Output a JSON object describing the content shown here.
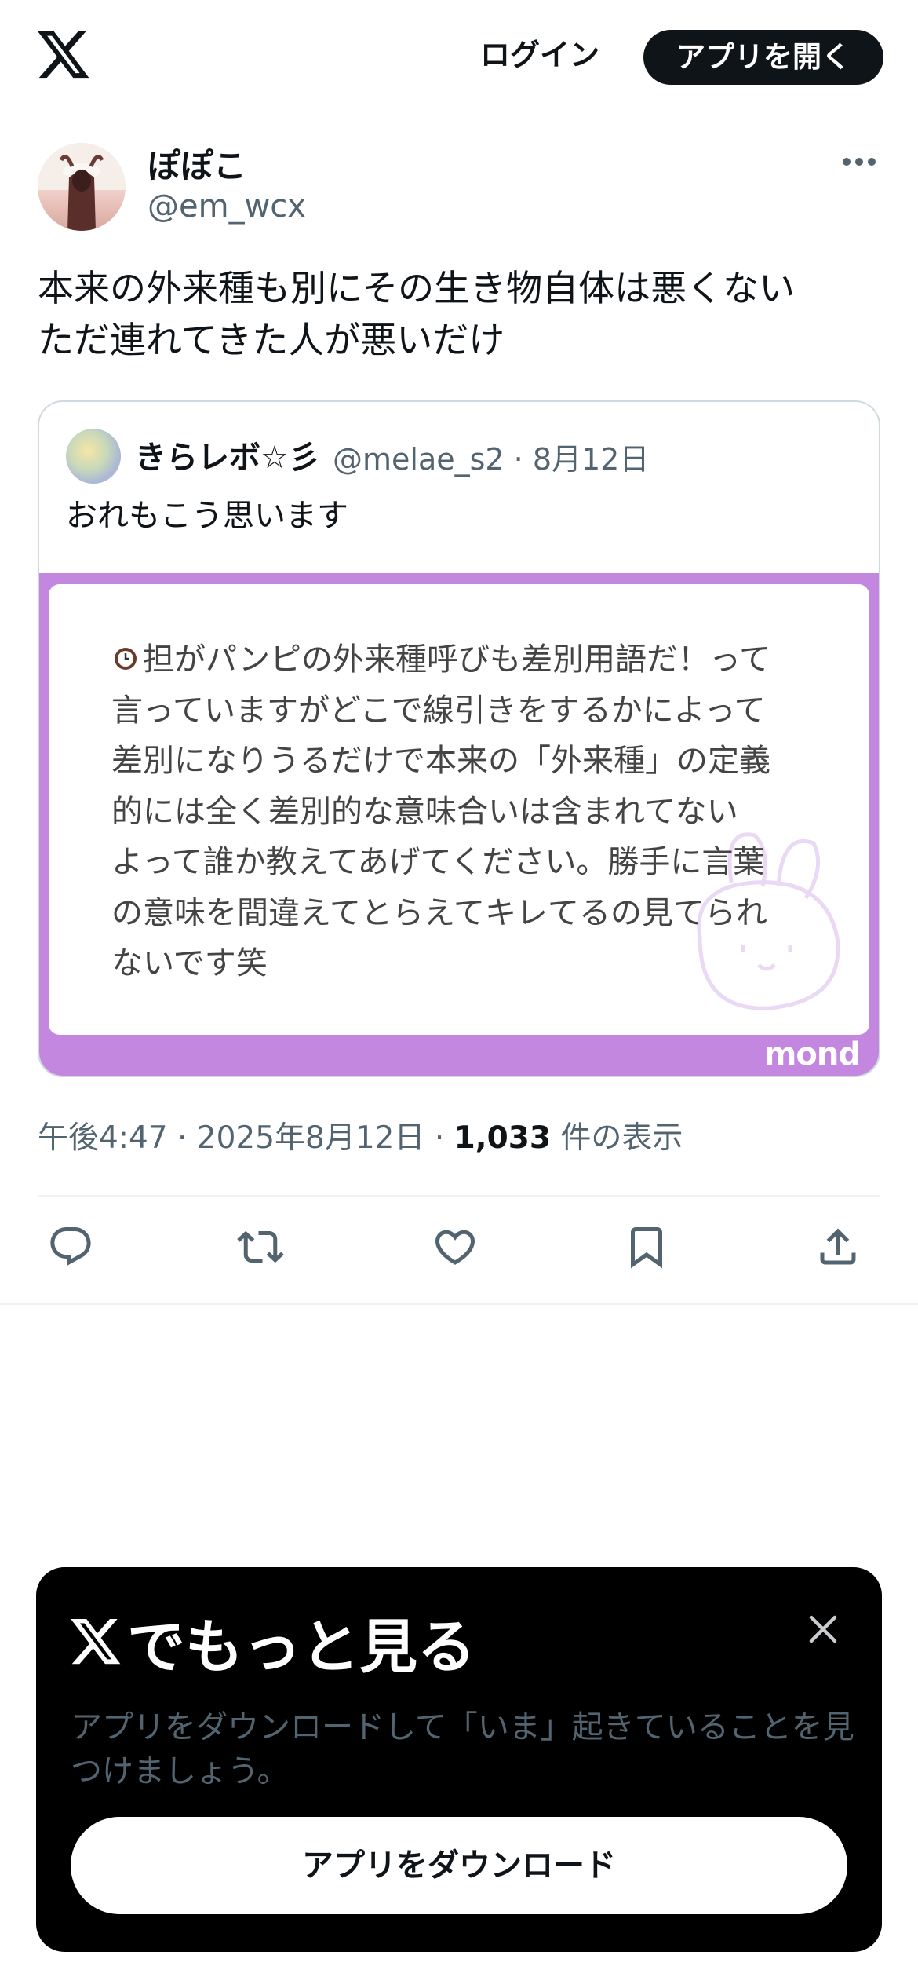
{
  "header": {
    "logo_icon": "x-logo-icon",
    "login_label": "ログイン",
    "open_app_label": "アプリを開く"
  },
  "post": {
    "display_name": "ぽぽこ",
    "handle": "@em_wcx",
    "text": "本来の外来種も別にその生き物自体は悪くない\nただ連れてきた人が悪いだけ",
    "more_icon": "more-horizontal-icon"
  },
  "quote": {
    "display_name": "きらレボ☆彡",
    "handle_date": "@melae_s2 · 8月12日",
    "text": "おれもこう思います",
    "image_text": "担がパンピの外来種呼びも差別用語だ！って\n言っていますがどこで線引きをするかによって\n差別になりうるだけで本来の「外来種」の定義\n的には全く差別的な意味合いは含まれてない\nよって誰か教えてあげてください。勝手に言葉\nの意味を間違えてとらえてキレてるの見てられ\nないです笑",
    "image_brand": "mond",
    "image_bg_color": "#c387e0"
  },
  "meta": {
    "time_date": "午後4:47 · 2025年8月12日 · ",
    "views_count": "1,033",
    "views_label": " 件の表示"
  },
  "actions": [
    {
      "icon": "reply-icon"
    },
    {
      "icon": "repost-icon"
    },
    {
      "icon": "like-icon"
    },
    {
      "icon": "bookmark-icon"
    },
    {
      "icon": "share-icon"
    }
  ],
  "promo": {
    "title": "でもっと見る",
    "description": "アプリをダウンロードして「いま」起きていることを見つけましょう。",
    "button_label": "アプリをダウンロード",
    "close_icon": "close-icon"
  }
}
